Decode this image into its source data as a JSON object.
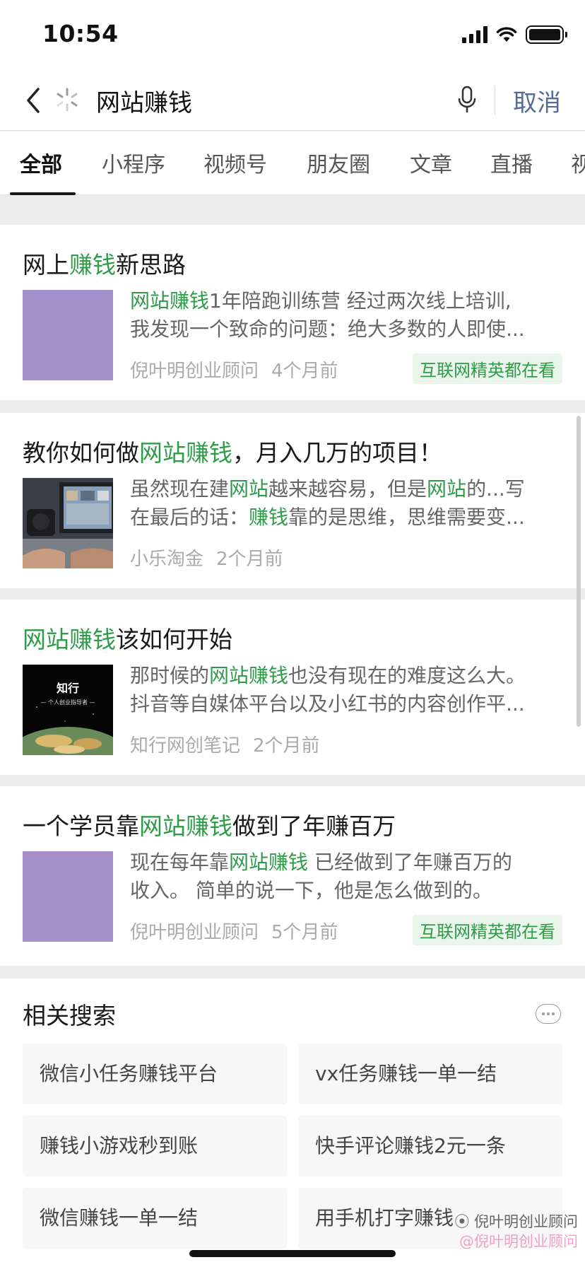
{
  "status_bar": {
    "time": "10:54"
  },
  "search": {
    "query": "网站赚钱",
    "cancel_label": "取消"
  },
  "tabs": [
    "全部",
    "小程序",
    "视频号",
    "朋友圈",
    "文章",
    "直播",
    "视"
  ],
  "results": [
    {
      "title_parts": [
        "网上",
        "赚钱",
        "新思路"
      ],
      "snippet_line1": [
        "网站赚钱",
        "1年陪跑训练营 经过两次线上培训,"
      ],
      "snippet_line2": "我发现一个致命的问题：绝大多数的人即使...",
      "source": "倪叶明创业顾问",
      "time": "4个月前",
      "badge": "互联网精英都在看"
    },
    {
      "title_parts": [
        "教你如何做",
        "网站赚钱",
        "，月入几万的项目！"
      ],
      "snippet_line1": [
        "虽然现在建",
        "网站",
        "越来越容易，但是",
        "网站",
        "的...写"
      ],
      "snippet_line2": [
        "在最后的话：",
        "赚钱",
        "靠的是思维，思维需要变..."
      ],
      "source": "小乐淘金",
      "time": "2个月前"
    },
    {
      "title_parts": [
        "网站赚钱",
        "该如何开始"
      ],
      "snippet_line1": [
        "那时候的",
        "网站赚钱",
        "也没有现在的难度这么大。"
      ],
      "snippet_line2": "抖音等自媒体平台以及小红书的内容创作平...",
      "source": "知行网创笔记",
      "time": "2个月前",
      "thumb_title": "知行",
      "thumb_subtitle": "— 个人创业指导者 —"
    },
    {
      "title_parts": [
        "一个学员靠",
        "网站赚钱",
        "做到了年赚百万"
      ],
      "snippet_line1": [
        "现在每年靠",
        "网站赚钱",
        " 已经做到了年赚百万的"
      ],
      "snippet_line2": "收入。 简单的说一下，他是怎么做到的。",
      "source": "倪叶明创业顾问",
      "time": "5个月前",
      "badge": "互联网精英都在看"
    }
  ],
  "related": {
    "title": "相关搜索",
    "items": [
      "微信小任务赚钱平台",
      "vx任务赚钱一单一结",
      "赚钱小游戏秒到账",
      "快手评论赚钱2元一条",
      "微信赚钱一单一结",
      "用手机打字赚钱"
    ]
  },
  "watermark": {
    "line1": "倪叶明创业顾问",
    "line2": "@倪叶明创业顾问"
  },
  "colors": {
    "highlight": "#2e9b48",
    "cancel": "#576b95",
    "thumb_purple": "#a58fca",
    "badge_bg": "#eaf6ec"
  }
}
